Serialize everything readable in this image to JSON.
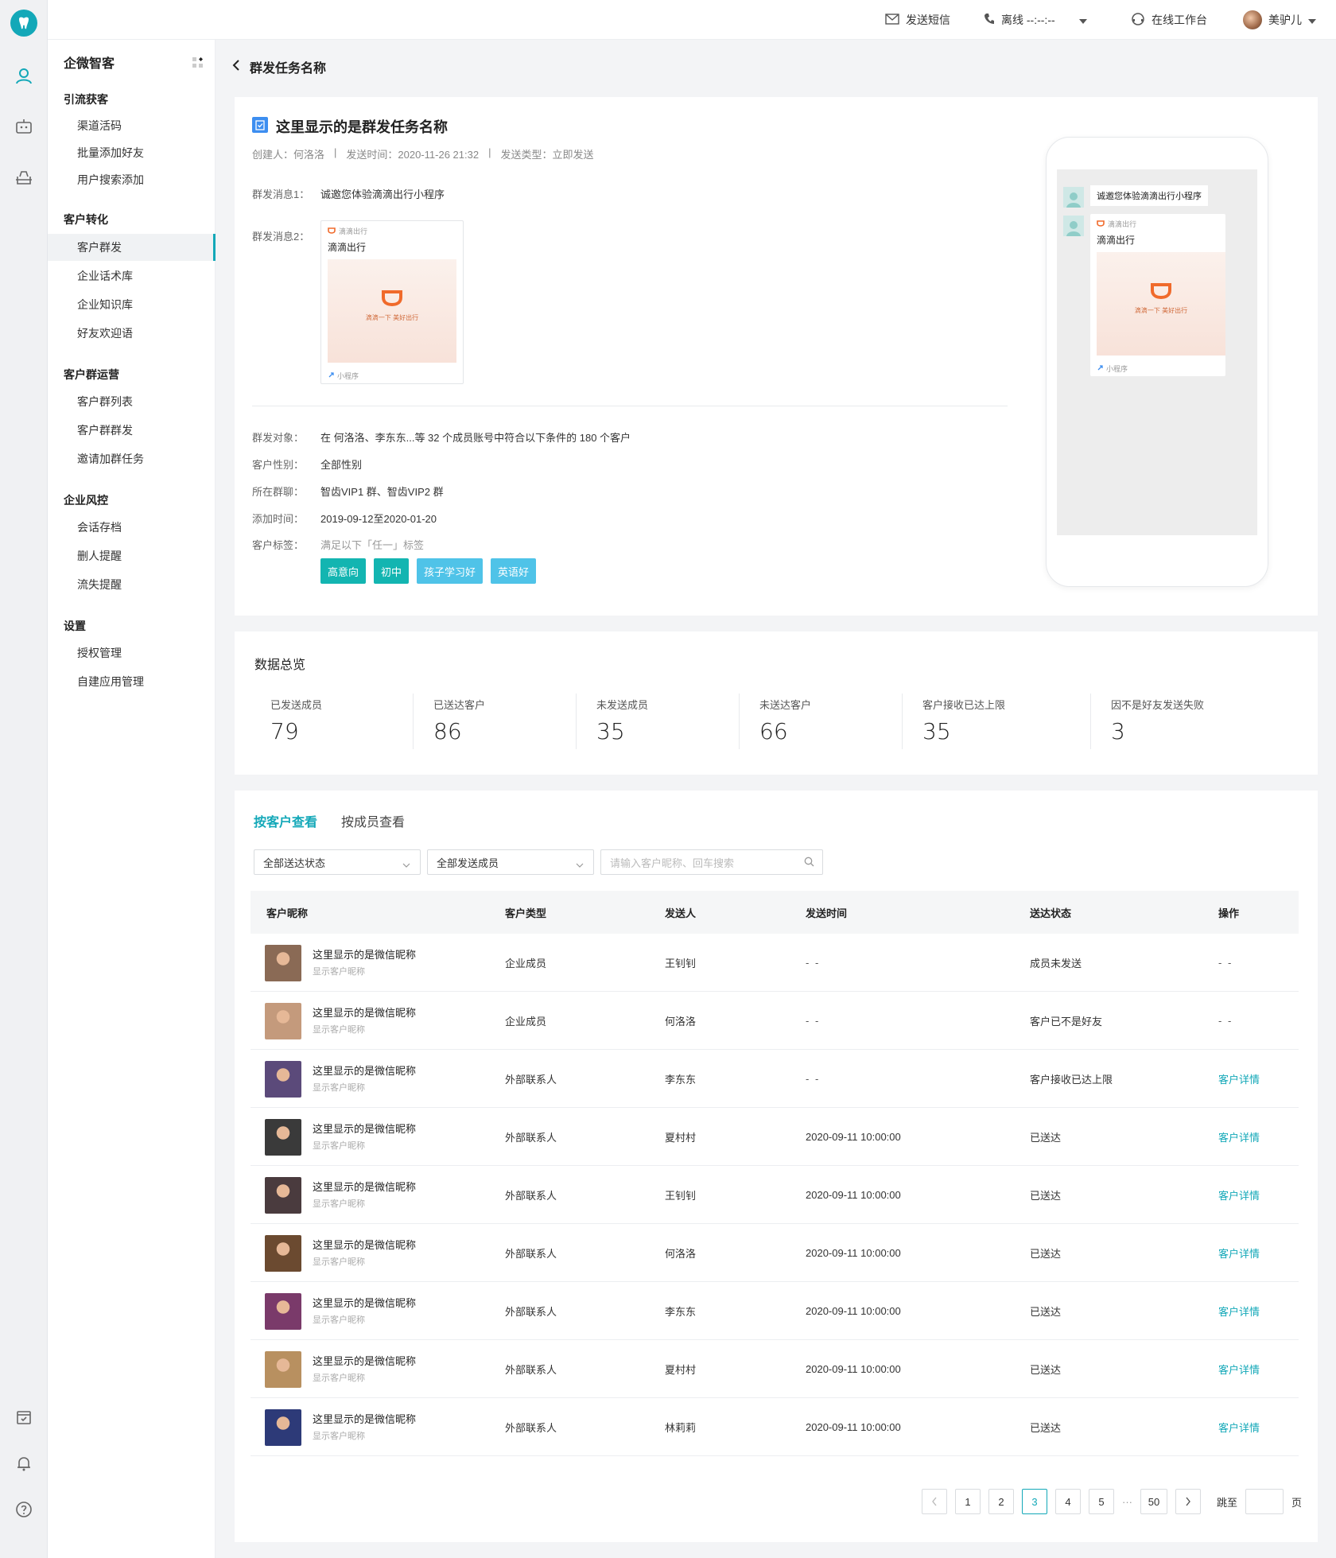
{
  "topbar": {
    "send_sms": "发送短信",
    "phone_status": "离线 --:--:--",
    "workbench": "在线工作台",
    "user_name": "美驴儿"
  },
  "nav": {
    "brand": "企微智客",
    "groups": [
      {
        "title": "引流获客",
        "items": [
          "渠道活码",
          "批量添加好友",
          "用户搜索添加"
        ]
      },
      {
        "title": "客户转化",
        "items": [
          "客户群发",
          "企业话术库",
          "企业知识库",
          "好友欢迎语"
        ]
      },
      {
        "title": "客户群运营",
        "items": [
          "客户群列表",
          "客户群群发",
          "邀请加群任务"
        ]
      },
      {
        "title": "企业风控",
        "items": [
          "会话存档",
          "删人提醒",
          "流失提醒"
        ]
      },
      {
        "title": "设置",
        "items": [
          "授权管理",
          "自建应用管理"
        ]
      }
    ],
    "active_item": "客户群发"
  },
  "page": {
    "back_title": "群发任务名称"
  },
  "task": {
    "title": "这里显示的是群发任务名称",
    "creator": "创建人：何洛洛",
    "send_time": "发送时间：2020-11-26 21:32",
    "send_type": "发送类型：立即发送",
    "msg1_label": "群发消息1：",
    "msg1_value": "诚邀您体验滴滴出行小程序",
    "msg2_label": "群发消息2：",
    "mini_program": {
      "source": "滴滴出行",
      "name": "滴滴出行",
      "slogan": "滴滴一下 美好出行",
      "footer": "小程序"
    },
    "target_label": "群发对象：",
    "target_value": "在 何洛洛、李东东...等 32 个成员账号中符合以下条件的 180 个客户",
    "gender_label": "客户性别：",
    "gender_value": "全部性别",
    "group_label": "所在群聊：",
    "group_value": "智齿VIP1 群、智齿VIP2 群",
    "added_label": "添加时间：",
    "added_value": "2019-09-12至2020-01-20",
    "tag_label": "客户标签：",
    "tag_hint": "满足以下「任一」标签",
    "tags": [
      {
        "text": "高意向",
        "color": "#13b5b1"
      },
      {
        "text": "初中",
        "color": "#13b5b1"
      },
      {
        "text": "孩子学习好",
        "color": "#4fc3e8"
      },
      {
        "text": "英语好",
        "color": "#4fc3e8"
      }
    ]
  },
  "preview": {
    "bubble_text": "诚邀您体验滴滴出行小程序",
    "mini_source": "滴滴出行",
    "mini_name": "滴滴出行",
    "mini_slogan": "滴滴一下 美好出行",
    "mini_footer": "小程序"
  },
  "overview": {
    "title": "数据总览",
    "stats": [
      {
        "label": "已发送成员",
        "value": "79"
      },
      {
        "label": "已送达客户",
        "value": "86"
      },
      {
        "label": "未发送成员",
        "value": "35"
      },
      {
        "label": "未送达客户",
        "value": "66"
      },
      {
        "label": "客户接收已达上限",
        "value": "35"
      },
      {
        "label": "因不是好友发送失败",
        "value": "3"
      }
    ]
  },
  "list": {
    "tabs": [
      "按客户查看",
      "按成员查看"
    ],
    "filter_status": "全部送达状态",
    "filter_member": "全部发送成员",
    "search_placeholder": "请输入客户昵称、回车搜索",
    "headers": [
      "客户昵称",
      "客户类型",
      "发送人",
      "发送时间",
      "送达状态",
      "操作"
    ],
    "rows": [
      {
        "nick": "这里显示的是微信昵称",
        "sub": "显示客户昵称",
        "type": "企业成员",
        "sender": "王钊钊",
        "time": "- -",
        "status": "成员未发送",
        "action": "- -",
        "action_link": false,
        "avatar_color": "#8a6a55"
      },
      {
        "nick": "这里显示的是微信昵称",
        "sub": "显示客户昵称",
        "type": "企业成员",
        "sender": "何洛洛",
        "time": "- -",
        "status": "客户已不是好友",
        "action": "- -",
        "action_link": false,
        "avatar_color": "#c49a7c"
      },
      {
        "nick": "这里显示的是微信昵称",
        "sub": "显示客户昵称",
        "type": "外部联系人",
        "sender": "李东东",
        "time": "- -",
        "status": "客户接收已达上限",
        "action": "客户详情",
        "action_link": true,
        "avatar_color": "#5b4a7a"
      },
      {
        "nick": "这里显示的是微信昵称",
        "sub": "显示客户昵称",
        "type": "外部联系人",
        "sender": "夏村村",
        "time": "2020-09-11 10:00:00",
        "status": "已送达",
        "action": "客户详情",
        "action_link": true,
        "avatar_color": "#3a3a3a"
      },
      {
        "nick": "这里显示的是微信昵称",
        "sub": "显示客户昵称",
        "type": "外部联系人",
        "sender": "王钊钊",
        "time": "2020-09-11 10:00:00",
        "status": "已送达",
        "action": "客户详情",
        "action_link": true,
        "avatar_color": "#4a3b3e"
      },
      {
        "nick": "这里显示的是微信昵称",
        "sub": "显示客户昵称",
        "type": "外部联系人",
        "sender": "何洛洛",
        "time": "2020-09-11 10:00:00",
        "status": "已送达",
        "action": "客户详情",
        "action_link": true,
        "avatar_color": "#6b4a30"
      },
      {
        "nick": "这里显示的是微信昵称",
        "sub": "显示客户昵称",
        "type": "外部联系人",
        "sender": "李东东",
        "time": "2020-09-11 10:00:00",
        "status": "已送达",
        "action": "客户详情",
        "action_link": true,
        "avatar_color": "#7a3a6a"
      },
      {
        "nick": "这里显示的是微信昵称",
        "sub": "显示客户昵称",
        "type": "外部联系人",
        "sender": "夏村村",
        "time": "2020-09-11 10:00:00",
        "status": "已送达",
        "action": "客户详情",
        "action_link": true,
        "avatar_color": "#b89060"
      },
      {
        "nick": "这里显示的是微信昵称",
        "sub": "显示客户昵称",
        "type": "外部联系人",
        "sender": "林莉莉",
        "time": "2020-09-11 10:00:00",
        "status": "已送达",
        "action": "客户详情",
        "action_link": true,
        "avatar_color": "#2d3a78"
      }
    ],
    "pager": {
      "pages": [
        "1",
        "2",
        "3",
        "4",
        "5"
      ],
      "current": "3",
      "ellipsis": "···",
      "last": "50",
      "jump_label": "跳至",
      "page_unit": "页"
    }
  },
  "colors": {
    "accent": "#13a8b8",
    "brand_orange": "#f06a2b"
  },
  "icons": [
    "logo-icon",
    "customer-icon",
    "robot-icon",
    "scan-icon",
    "calendar-icon",
    "bell-icon",
    "help-icon",
    "mail-icon",
    "phone-icon",
    "headset-icon",
    "caret-down-icon",
    "back-arrow-icon",
    "task-icon",
    "link-icon",
    "search-icon",
    "chevron-left-icon",
    "chevron-right-icon"
  ]
}
